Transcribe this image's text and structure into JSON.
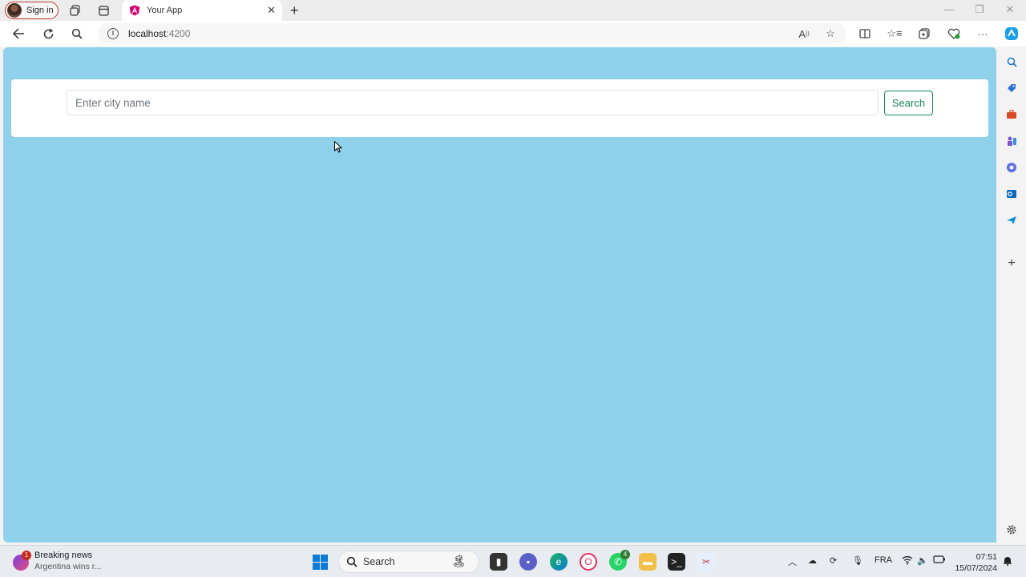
{
  "browser": {
    "profile_label": "Sign in",
    "tab_title": "Your App",
    "address_host": "localhost",
    "address_port": ":4200"
  },
  "page": {
    "search_placeholder": "Enter city name",
    "search_value": "",
    "search_button_label": "Search",
    "background_color": "#8fd1ea",
    "button_color": "#198754"
  },
  "taskbar": {
    "news_title": "Breaking news",
    "news_subtitle": "Argentina wins r...",
    "news_badge": "1",
    "search_label": "Search",
    "whatsapp_badge": "4",
    "language": "FRA",
    "time": "07:51",
    "date": "15/07/2024"
  }
}
